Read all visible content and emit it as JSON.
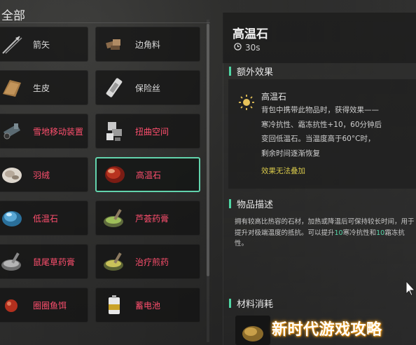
{
  "inventory": {
    "category_title": "全部",
    "items": [
      {
        "label": "箭矢",
        "icon": "arrow-icon",
        "highlight": false
      },
      {
        "label": "边角料",
        "icon": "scrap-icon",
        "highlight": false
      },
      {
        "label": "生皮",
        "icon": "rawhide-icon",
        "highlight": false
      },
      {
        "label": "保险丝",
        "icon": "fuse-icon",
        "highlight": false
      },
      {
        "label": "雪地移动装置",
        "icon": "snow-mobile-device-icon",
        "highlight": true
      },
      {
        "label": "扭曲空间",
        "icon": "twisted-space-icon",
        "highlight": true
      },
      {
        "label": "羽绒",
        "icon": "down-feather-icon",
        "highlight": true
      },
      {
        "label": "高温石",
        "icon": "hot-stone-icon",
        "highlight": true,
        "selected": true
      },
      {
        "label": "低温石",
        "icon": "cold-stone-icon",
        "highlight": true
      },
      {
        "label": "芦荟药膏",
        "icon": "aloe-ointment-icon",
        "highlight": true
      },
      {
        "label": "鼠尾草药膏",
        "icon": "sage-ointment-icon",
        "highlight": true
      },
      {
        "label": "治疗煎药",
        "icon": "healing-decoction-icon",
        "highlight": true
      },
      {
        "label": "圈圈鱼饵",
        "icon": "ring-bait-icon",
        "highlight": true
      },
      {
        "label": "蓄电池",
        "icon": "battery-icon",
        "highlight": true
      }
    ]
  },
  "detail": {
    "name": "高温石",
    "timer": "30s",
    "extra_effect_title": "额外效果",
    "effect_name": "高温石",
    "effect_lines": [
      "背包中携带此物品时，获得效果——",
      "寒冷抗性、霜冻抗性+10，60分钟后",
      "变回低温石。当温度高于60°C时，",
      "剩余时间逐渐恢复"
    ],
    "effect_warning": "效果无法叠加",
    "desc_title": "物品描述",
    "desc_part1": "拥有较高比热容的石材，加热或降温后可保持较长时间，用于提升对极端温度的抵抗。可以提升",
    "desc_num1": "10",
    "desc_part2": "寒冷抗性和",
    "desc_num2": "10",
    "desc_part3": "霜冻抗性。",
    "materials_title": "材料消耗"
  },
  "watermark": "新时代游戏攻略",
  "colors": {
    "accent": "#4fd6a4",
    "select_border": "#62d3ac",
    "red_label": "#ff4f6e",
    "warning": "#d7c84a"
  }
}
